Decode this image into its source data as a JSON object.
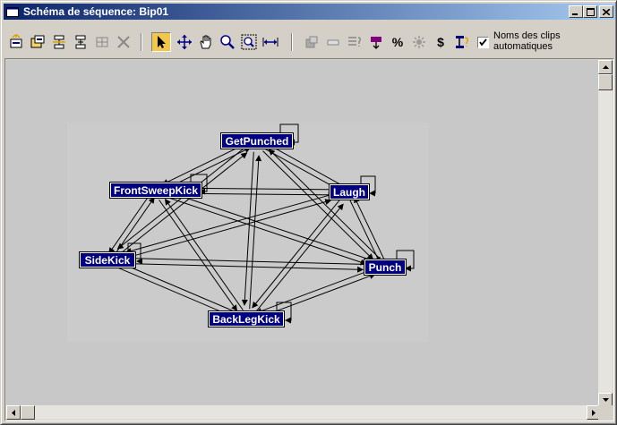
{
  "window": {
    "title": "Schéma de séquence: Bip01",
    "controls": {
      "minimize": "minimize-icon",
      "maximize": "maximize-icon",
      "close": "close-icon"
    }
  },
  "toolbar": {
    "tools": [
      {
        "id": "new-clip",
        "icon": "new-clip-icon"
      },
      {
        "id": "insert-clip",
        "icon": "insert-clip-icon"
      },
      {
        "id": "insert-transition",
        "icon": "insert-transition-icon"
      },
      {
        "id": "transition-out",
        "icon": "transition-out-icon"
      },
      {
        "id": "delete-grayed",
        "icon": "grid-icon"
      },
      {
        "id": "delete",
        "icon": "delete-icon"
      },
      {
        "id": "select",
        "icon": "arrow-select-icon",
        "active": true
      },
      {
        "id": "move",
        "icon": "move-icon"
      },
      {
        "id": "pan",
        "icon": "hand-pan-icon"
      },
      {
        "id": "zoom",
        "icon": "zoom-icon"
      },
      {
        "id": "zoom-region",
        "icon": "zoom-region-icon"
      },
      {
        "id": "zoom-extents",
        "icon": "zoom-extents-icon"
      },
      {
        "id": "compute",
        "icon": "compute-icon"
      },
      {
        "id": "blank",
        "icon": "blank-box-icon"
      },
      {
        "id": "properties",
        "icon": "properties-icon"
      },
      {
        "id": "start-flag",
        "icon": "start-flag-icon"
      },
      {
        "id": "percent",
        "icon": "percent-icon",
        "label": "%"
      },
      {
        "id": "randomize",
        "icon": "randomize-icon"
      },
      {
        "id": "dollar",
        "icon": "dollar-icon",
        "label": "$"
      },
      {
        "id": "script",
        "icon": "script-icon"
      }
    ],
    "auto_clip_names": {
      "checked": true,
      "label": "Noms des clips\nautomatiques"
    }
  },
  "graph": {
    "nodes": [
      {
        "id": "getpunched",
        "label": "GetPunched"
      },
      {
        "id": "frontsweepkick",
        "label": "FrontSweepKick"
      },
      {
        "id": "laugh",
        "label": "Laugh"
      },
      {
        "id": "sidekick",
        "label": "SideKick"
      },
      {
        "id": "punch",
        "label": "Punch"
      },
      {
        "id": "backlegkick",
        "label": "BackLegKick"
      }
    ]
  },
  "colors": {
    "titlebar_start": "#0a246a",
    "titlebar_end": "#a6caf0",
    "node_bg": "#000080",
    "active_tool": "#f2c64a",
    "canvas_bg": "#c8c8c8"
  }
}
